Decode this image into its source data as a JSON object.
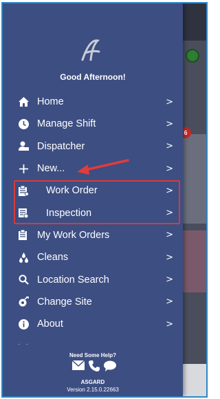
{
  "greeting": "Good Afternoon!",
  "menu": {
    "items": [
      {
        "label": "Home",
        "icon": "home-icon"
      },
      {
        "label": "Manage Shift",
        "icon": "clock-icon"
      },
      {
        "label": "Dispatcher",
        "icon": "dispatcher-icon"
      },
      {
        "label": "New...",
        "icon": "plus-icon"
      },
      {
        "label": "Work Order",
        "icon": "clipboard-icon"
      },
      {
        "label": "Inspection",
        "icon": "checklist-icon"
      },
      {
        "label": "My Work Orders",
        "icon": "clipboard-icon"
      },
      {
        "label": "Cleans",
        "icon": "drops-icon"
      },
      {
        "label": "Location Search",
        "icon": "search-icon"
      },
      {
        "label": "Change Site",
        "icon": "site-icon"
      },
      {
        "label": "About",
        "icon": "info-icon"
      }
    ],
    "chevron": ">"
  },
  "footer": {
    "help": "Need Some Help?",
    "brand": "ASGARD",
    "version": "Version 2.15.0.22663"
  },
  "badges": {
    "red_count": "6"
  },
  "colors": {
    "drawer_bg": "#3d4e82",
    "highlight": "#d93a3a",
    "frame": "#2e86c8"
  }
}
